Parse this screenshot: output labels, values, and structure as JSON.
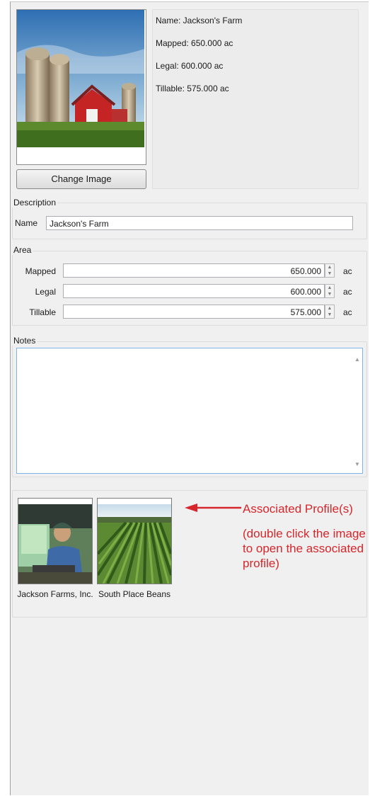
{
  "summary": {
    "name": "Name: Jackson's Farm",
    "mapped": "Mapped: 650.000 ac",
    "legal": "Legal: 600.000 ac",
    "tillable": "Tillable: 575.000 ac"
  },
  "image": {
    "change_button": "Change Image"
  },
  "description": {
    "legend": "Description",
    "name_label": "Name",
    "name_value": "Jackson's Farm"
  },
  "area": {
    "legend": "Area",
    "rows": [
      {
        "label": "Mapped",
        "value": "650.000",
        "unit": "ac"
      },
      {
        "label": "Legal",
        "value": "600.000",
        "unit": "ac"
      },
      {
        "label": "Tillable",
        "value": "575.000",
        "unit": "ac"
      }
    ]
  },
  "notes": {
    "legend": "Notes",
    "value": ""
  },
  "profiles": {
    "items": [
      {
        "caption": "Jackson Farms, Inc."
      },
      {
        "caption": "South Place Beans"
      }
    ],
    "annotation_title": "Associated Profile(s)",
    "annotation_body": "(double click the image to open the associated profile)"
  },
  "colors": {
    "annotation": "#d6262b",
    "notes_border": "#7eb4ea"
  }
}
